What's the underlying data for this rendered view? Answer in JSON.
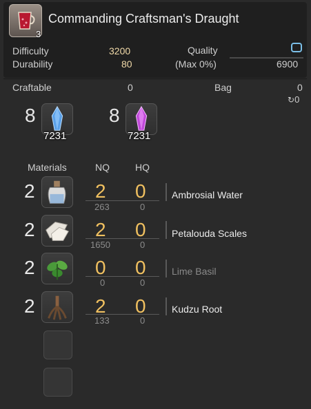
{
  "item": {
    "name": "Commanding Craftsman's Draught",
    "count": "3"
  },
  "stats": {
    "difficulty_label": "Difficulty",
    "difficulty_value": "3200",
    "durability_label": "Durability",
    "durability_value": "80",
    "quality_label": "Quality",
    "quality_max_label": "(Max 0%)",
    "quality_value": "6900",
    "quality_fill": 0
  },
  "inventory": {
    "craftable_label": "Craftable",
    "craftable_value": "0",
    "bag_label": "Bag",
    "bag_value": "0",
    "hq_value": "0"
  },
  "crystals": [
    {
      "required": "8",
      "owned": "7231",
      "color": "#5aa0e8",
      "icon": "water-crystal-icon"
    },
    {
      "required": "8",
      "owned": "7231",
      "color": "#d060e0",
      "icon": "lightning-crystal-icon"
    }
  ],
  "materials_header": {
    "materials": "Materials",
    "nq": "NQ",
    "hq": "HQ"
  },
  "materials": [
    {
      "required": "2",
      "nq": "2",
      "hq": "0",
      "nq_have": "263",
      "hq_have": "0",
      "name": "Ambrosial Water",
      "available": true,
      "icon": "water-bottle-icon"
    },
    {
      "required": "2",
      "nq": "2",
      "hq": "0",
      "nq_have": "1650",
      "hq_have": "0",
      "name": "Petalouda Scales",
      "available": true,
      "icon": "scales-icon"
    },
    {
      "required": "2",
      "nq": "0",
      "hq": "0",
      "nq_have": "0",
      "hq_have": "0",
      "name": "Lime Basil",
      "available": false,
      "icon": "basil-leaf-icon"
    },
    {
      "required": "2",
      "nq": "2",
      "hq": "0",
      "nq_have": "133",
      "hq_have": "0",
      "name": "Kudzu Root",
      "available": true,
      "icon": "root-icon"
    }
  ],
  "colors": {
    "accent_yellow": "#f0c060",
    "quality_blue": "#7bbfe8"
  }
}
